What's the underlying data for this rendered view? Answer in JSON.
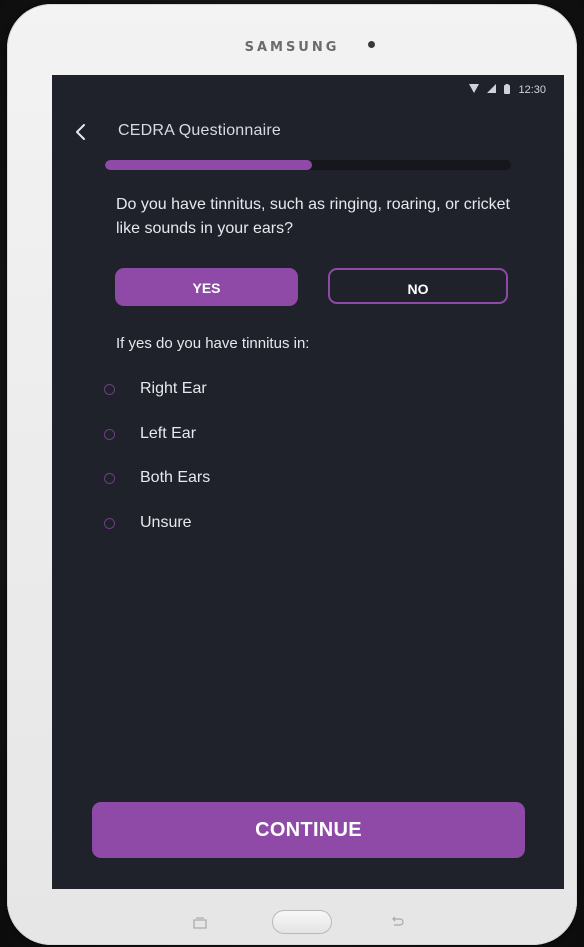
{
  "device": {
    "brand": "SAMSUNG"
  },
  "status_bar": {
    "icons": [
      "wifi-icon",
      "signal-icon",
      "battery-icon"
    ],
    "time": "12:30"
  },
  "app_bar": {
    "back_icon": "chevron-left-icon",
    "title": "CEDRA Questionnaire"
  },
  "progress": {
    "fraction": 0.51
  },
  "question": {
    "text": "Do you have tinnitus, such as ringing, roaring, or cricket like sounds in your ears?"
  },
  "answer_buttons": {
    "yes_label": "YES",
    "no_label": "NO",
    "selected": "YES"
  },
  "follow_up": {
    "text": "If yes do you have tinnitus in:",
    "options": [
      {
        "label": "Right Ear",
        "selected": false
      },
      {
        "label": "Left Ear",
        "selected": false
      },
      {
        "label": "Both Ears",
        "selected": false
      },
      {
        "label": "Unsure",
        "selected": false
      }
    ]
  },
  "footer": {
    "continue_label": "CONTINUE"
  },
  "hardware_buttons": {
    "recent_icon": "recent-apps-icon",
    "home_icon": "home-button-icon",
    "back_icon": "back-arrow-icon"
  },
  "colors": {
    "accent": "#8e4aa6",
    "screen_bg": "#1f222a",
    "text": "#e6e8ec",
    "device_body": "#eeeeee"
  }
}
